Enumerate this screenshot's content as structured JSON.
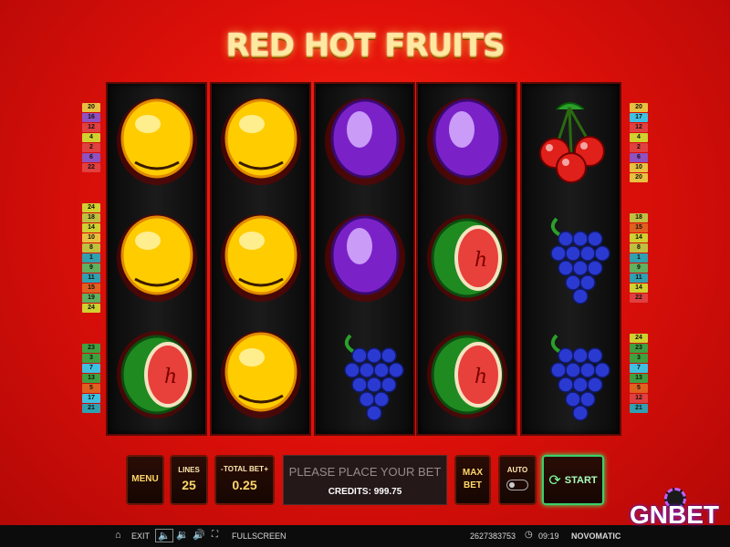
{
  "title": "RED HOT FRUITS",
  "reels": [
    [
      "lemon",
      "lemon",
      "watermelon"
    ],
    [
      "lemon",
      "lemon",
      "lemon"
    ],
    [
      "plum",
      "plum",
      "grapes"
    ],
    [
      "plum",
      "watermelon",
      "watermelon"
    ],
    [
      "cherries",
      "grapes",
      "grapes"
    ]
  ],
  "line_indicators": {
    "left_top": [
      "20",
      "16",
      "12",
      "4",
      "2",
      "6",
      "22"
    ],
    "left_mid": [
      "24",
      "18",
      "14",
      "10",
      "8",
      "1",
      "9",
      "11",
      "15",
      "19",
      "24"
    ],
    "left_bot": [
      "23",
      "3",
      "7",
      "13",
      "5",
      "17",
      "21"
    ],
    "right_top": [
      "20",
      "17",
      "12",
      "4",
      "2",
      "6",
      "10",
      "20"
    ],
    "right_mid": [
      "18",
      "15",
      "14",
      "8",
      "1",
      "9",
      "11",
      "14",
      "22"
    ],
    "right_bot": [
      "24",
      "23",
      "3",
      "7",
      "13",
      "5",
      "12",
      "21"
    ]
  },
  "line_colors": [
    "#e8c040",
    "#30a0b0",
    "#e04040",
    "#40a040",
    "#d0d030",
    "#e06020",
    "#9050c0",
    "#40c0e0",
    "#c0c040",
    "#60b060"
  ],
  "controls": {
    "menu_label": "MENU",
    "lines_label": "LINES",
    "lines_value": "25",
    "total_bet_label": "TOTAL BET",
    "total_bet_minus": "-",
    "total_bet_plus": "+",
    "total_bet_value": "0.25",
    "message": "PLEASE PLACE YOUR BET",
    "credits_label": "CREDITS: 999.75",
    "max_bet_line1": "MAX",
    "max_bet_line2": "BET",
    "auto_label": "AUTO",
    "start_label": "START"
  },
  "bottom_bar": {
    "exit_label": "EXIT",
    "fullscreen_label": "FULLSCREEN",
    "game_id": "2627383753",
    "time": "09:19",
    "brand": "NOVOMATIC"
  },
  "watermark": "GNBET"
}
